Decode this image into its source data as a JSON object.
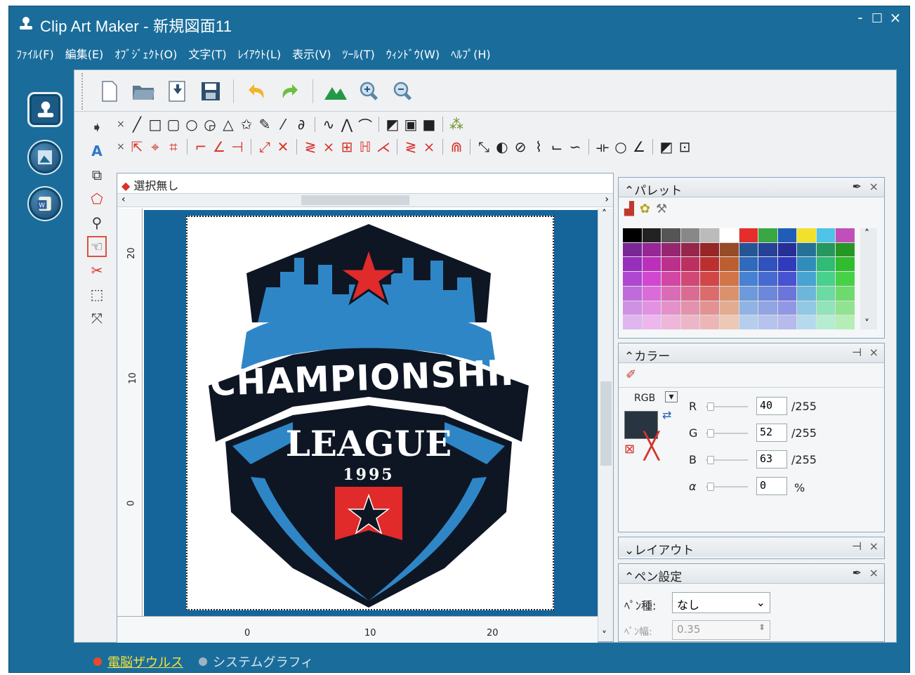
{
  "window": {
    "title": "Clip Art Maker - 新規図面11",
    "minimize": "-",
    "maximize": "□",
    "close": "×"
  },
  "menu": [
    "ﾌｧｲﾙ(F)",
    "編集(E)",
    "ｵﾌﾞｼﾞｪｸﾄ(O)",
    "文字(T)",
    "ﾚｲｱｳﾄ(L)",
    "表示(V)",
    "ﾂｰﾙ(T)",
    "ｳｨﾝﾄﾞｳ(W)",
    "ﾍﾙﾌﾟ(H)"
  ],
  "document": {
    "selection_label": "選択無し"
  },
  "ruler": {
    "vertical": [
      "20",
      "10",
      "0"
    ],
    "horizontal": [
      "0",
      "10",
      "20"
    ]
  },
  "artwork": {
    "banner_text": "CHAMPIONSHIP",
    "league_text": "LEAGUE",
    "year_text": "1995"
  },
  "palette_panel": {
    "title": "パレット",
    "colors": [
      "#000000",
      "#222222",
      "#555555",
      "#888888",
      "#bbbbbb",
      "#ffffff",
      "#e52e2b",
      "#3aa745",
      "#1f5db9",
      "#f2e12b",
      "#4fc3e8",
      "#c14fb9"
    ]
  },
  "color_panel": {
    "title": "カラー",
    "mode": "RGB",
    "r_label": "R",
    "g_label": "G",
    "b_label": "B",
    "alpha_label": "α",
    "r": "40",
    "g": "52",
    "b": "63",
    "alpha": "0",
    "max": "/255",
    "pct": "%",
    "current_color": "#28343f"
  },
  "layout_panel": {
    "title": "レイアウト"
  },
  "pen_panel": {
    "title": "ペン設定",
    "kind_label": "ﾍﾟﾝ種:",
    "kind_value": "なし",
    "width_label": "ﾍﾟﾝ幅:",
    "width_value": "0.35"
  },
  "status": {
    "item1": "電脳ザウルス",
    "item2": "システムグラフィ"
  }
}
